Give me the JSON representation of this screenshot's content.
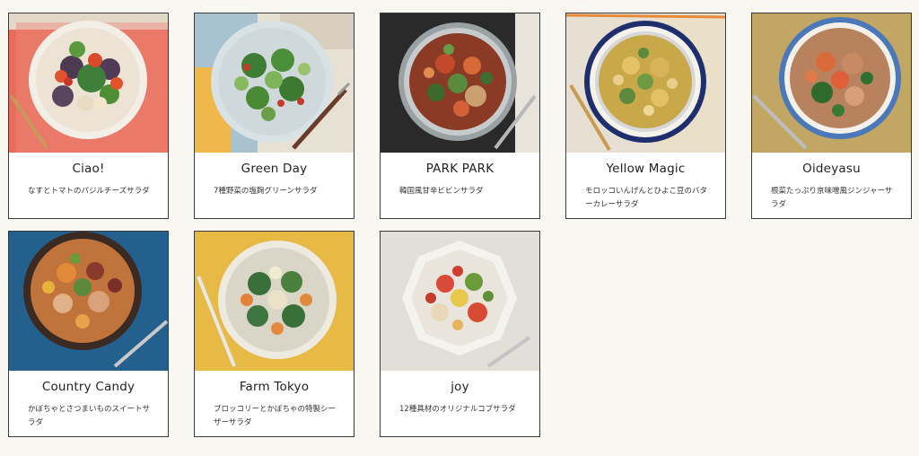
{
  "products": [
    {
      "name": "Ciao!",
      "description": "なすとトマトのバジルチーズサラダ"
    },
    {
      "name": "Green Day",
      "description": "7種野菜の塩麹グリーンサラダ"
    },
    {
      "name": "PARK PARK",
      "description": "韓国風甘辛ビビンサラダ"
    },
    {
      "name": "Yellow Magic",
      "description": "モロッコいんげんとひよこ豆のバターカレーサラダ"
    },
    {
      "name": "Oideyasu",
      "description": "根菜たっぷり京味噌風ジンジャーサラダ"
    },
    {
      "name": "Country Candy",
      "description": "かぼちゃとさつまいものスイートサラダ"
    },
    {
      "name": "Farm Tokyo",
      "description": "ブロッコリーとかぼちゃの特製シーザーサラダ"
    },
    {
      "name": "joy",
      "description": "12種具材のオリジナルコブサラダ"
    }
  ]
}
